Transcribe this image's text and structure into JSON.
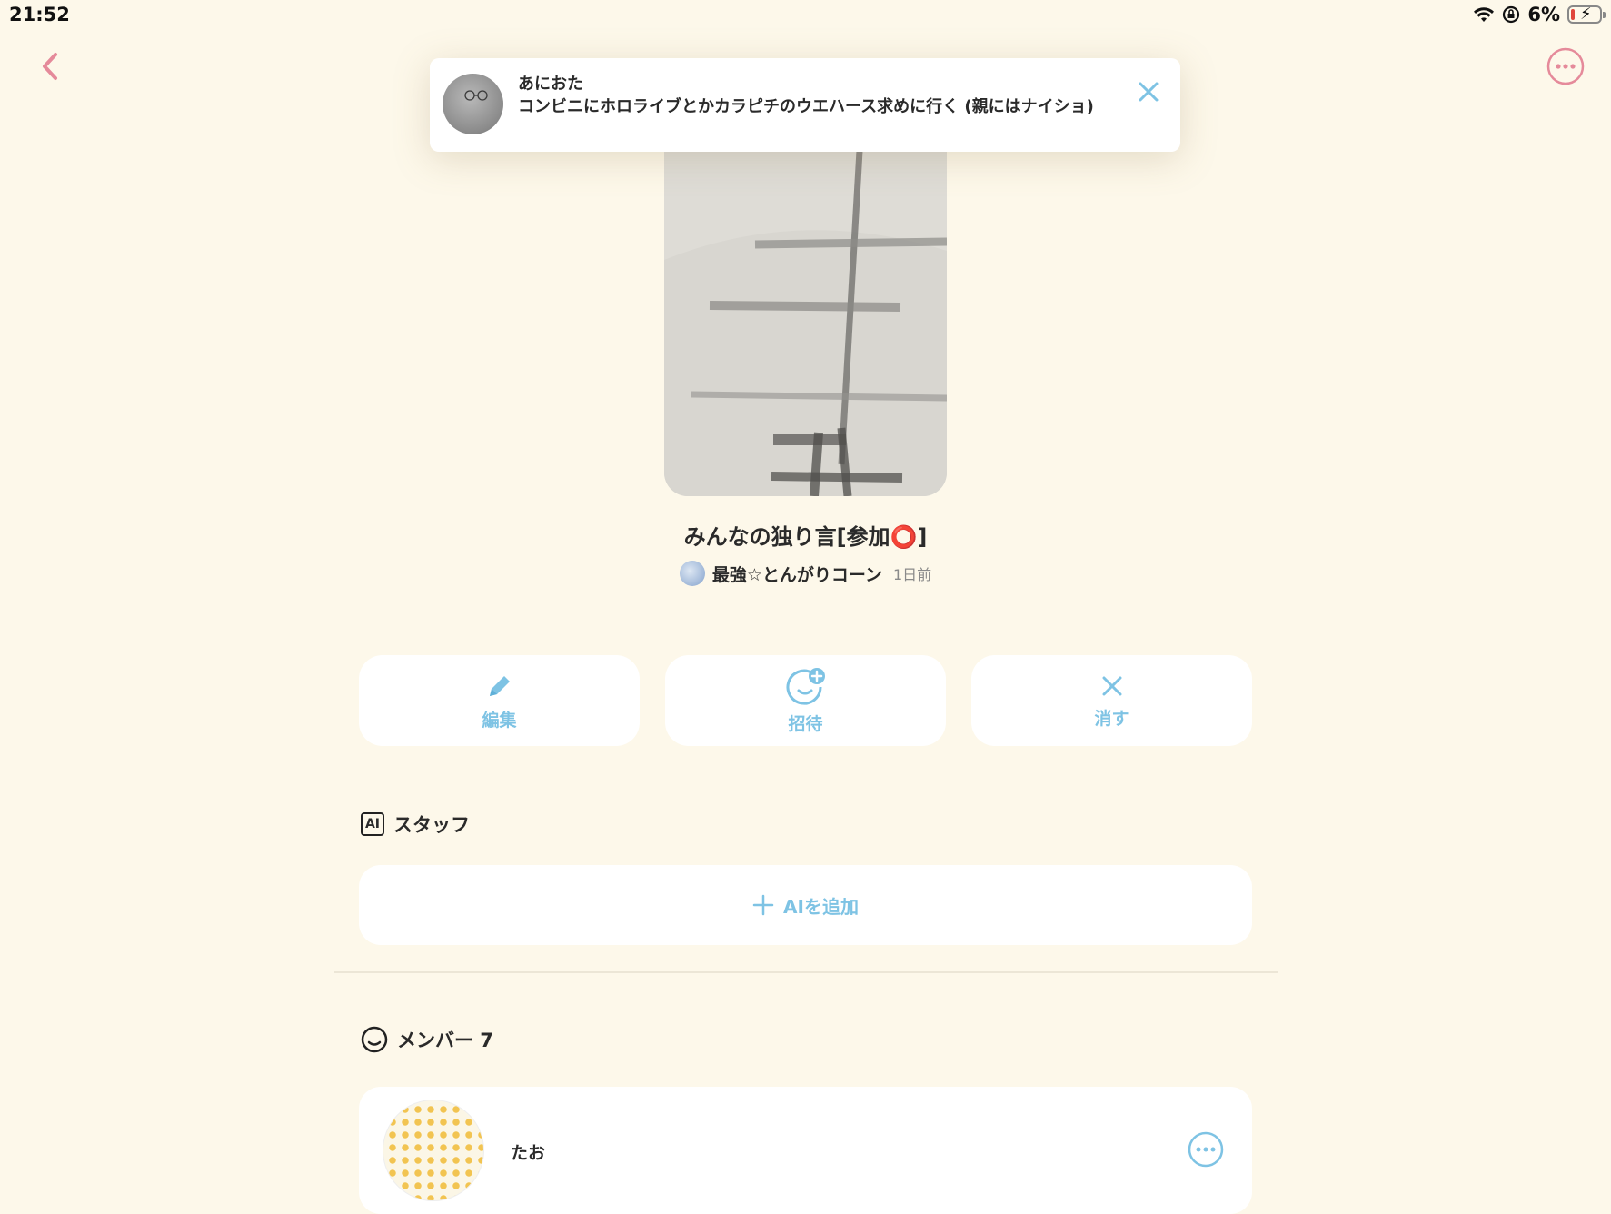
{
  "status_bar": {
    "time": "21:52",
    "battery": "6%",
    "battery_level": 0.06,
    "icons": [
      "wifi-icon",
      "rotation-lock-icon",
      "battery-charging-icon"
    ]
  },
  "header": {
    "back_icon": "chevron-left-icon",
    "more_icon": "ellipsis-circle-icon"
  },
  "notification": {
    "sender": "あにおた",
    "message": "コンビニにホロライブとかカラピチのウエハース求めに行く (親にはナイショ)",
    "close_icon": "close-icon"
  },
  "room": {
    "title": "みんなの独り言[参加⭕️]",
    "owner_name": "最強☆とんがりコーン",
    "updated": "1日前"
  },
  "actions": {
    "edit": "編集",
    "invite": "招待",
    "delete": "消す"
  },
  "staff": {
    "badge": "AI",
    "heading": "スタッフ",
    "add_ai": "AIを追加"
  },
  "members": {
    "heading": "メンバー 7",
    "items": [
      {
        "name": "たお"
      }
    ]
  },
  "colors": {
    "background": "#fdf8ea",
    "accent_blue": "#7ec3e4",
    "accent_pink": "#e58a9a"
  }
}
